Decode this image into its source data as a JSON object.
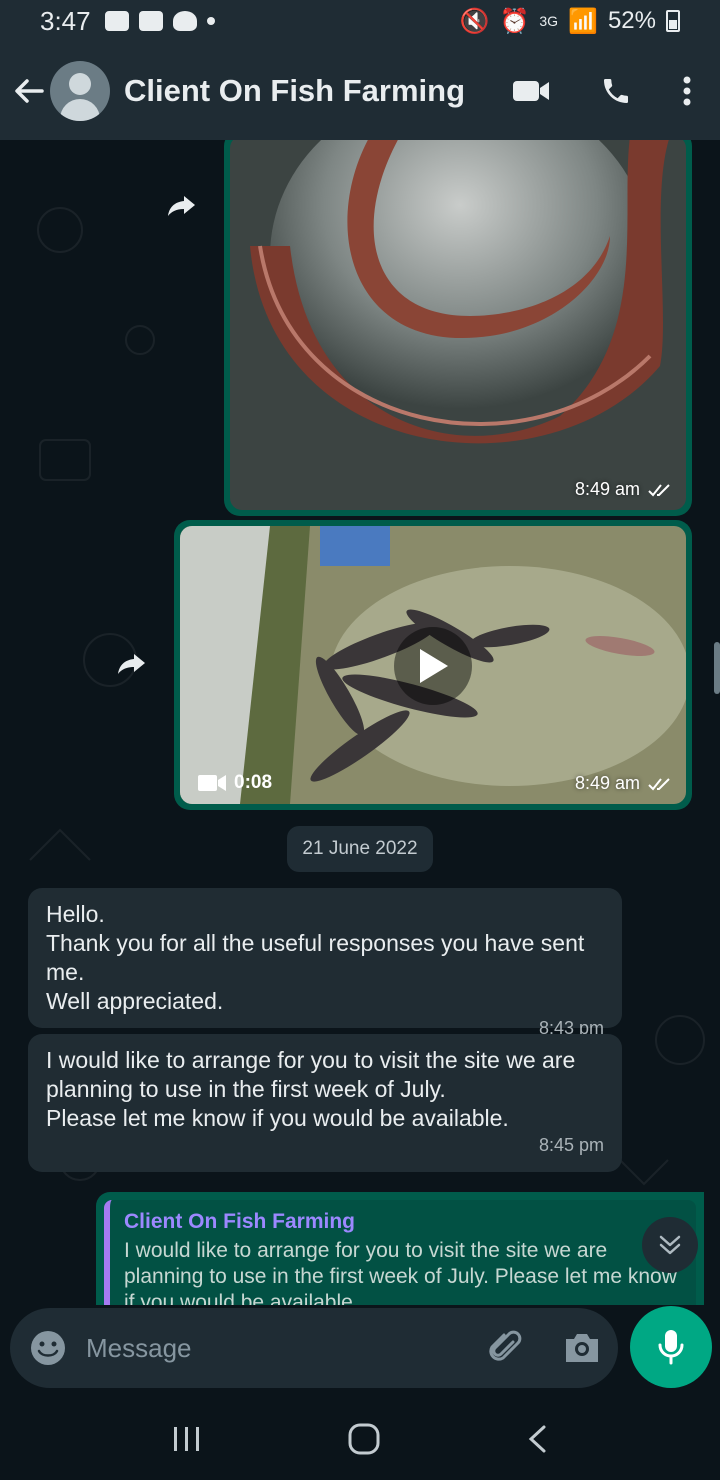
{
  "status_bar": {
    "time": "3:47",
    "network": "3G",
    "battery": "52%"
  },
  "header": {
    "title": "Client On Fish Farming"
  },
  "messages": {
    "image_time": "8:49 am",
    "video_duration": "0:08",
    "video_time": "8:49 am",
    "date_divider": "21 June 2022",
    "msg1_text": "Hello.\nThank you for all the useful responses you have sent me.\nWell appreciated.",
    "msg1_time": "8:43 pm",
    "msg2_text": "I would like to arrange for you to visit the site we are planning to use in the first week of July.\nPlease let me know if you would be available.",
    "msg2_time": "8:45 pm",
    "reply_quote_name": "Client On Fish Farming",
    "reply_quote_text": "I would like to arrange for you to visit the site we are planning to use in the first week of July. Please let me know if you would be available."
  },
  "composer": {
    "placeholder": "Message"
  },
  "colors": {
    "accent": "#00a884",
    "outgoing_bubble": "#005c4b",
    "incoming_bubble": "#202c33",
    "quote_name": "#9c88ff"
  }
}
